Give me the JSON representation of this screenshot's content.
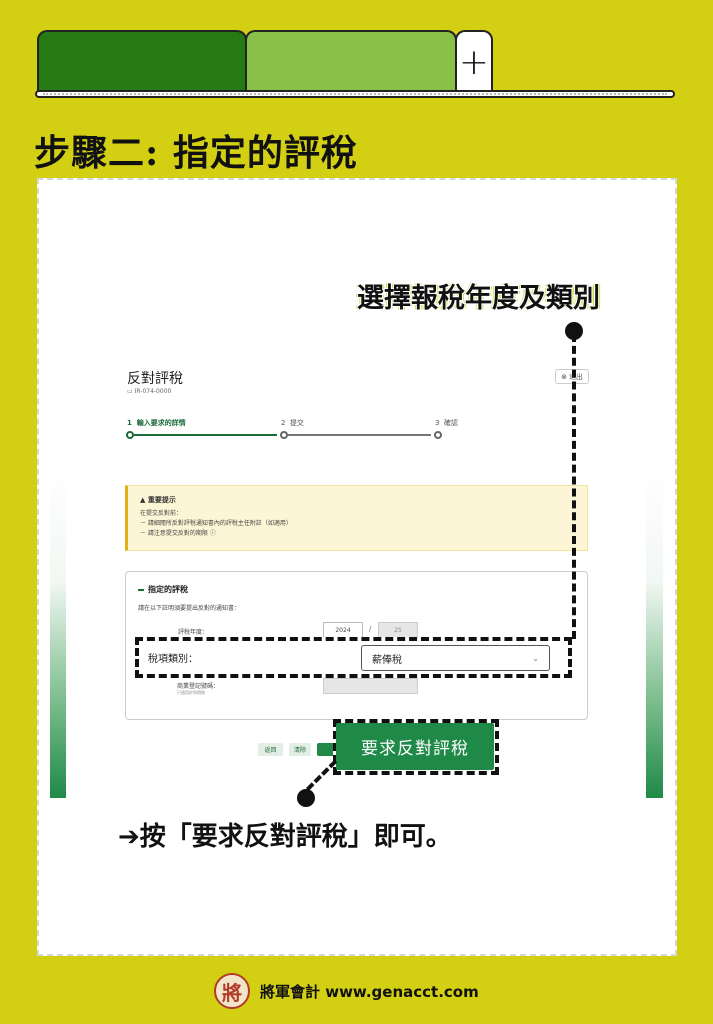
{
  "tabs": {
    "add_label": "+"
  },
  "step_title": "步驟二: 指定的評稅",
  "callout_top": "選擇報稅年度及類別",
  "app": {
    "title": "反對評稅",
    "subtitle": "IR-074-0000",
    "exit_label": "退出",
    "steps": [
      {
        "num": "1",
        "label": "輸入要求的詳情",
        "active": true
      },
      {
        "num": "2",
        "label": "提交",
        "active": false
      },
      {
        "num": "3",
        "label": "確認",
        "active": false
      }
    ],
    "notice": {
      "title": "重要提示",
      "lines": [
        "在提交反對前：",
        "－ 請細閱所反對評稅通知書內的評稅主任附註（如適用）",
        "－ 請注意提交反對的期限"
      ]
    },
    "form": {
      "heading": "指定的評稅",
      "description": "請在以下註明須要提出反對的通知書：",
      "year_label": "評稅年度：",
      "year_from": "2024",
      "year_sep": "/",
      "year_to": "25",
      "tax_type_label": "稅項類別：",
      "tax_type_value": "薪俸稅",
      "biz_label": "商業登記號碼：",
      "biz_note": "只適用於利得稅"
    },
    "buttons": {
      "back": "返回",
      "clear": "清除",
      "request": "要求反對評稅"
    }
  },
  "callout_bottom": "➔按「要求反對評稅」即可。",
  "footer": {
    "logo_char": "將",
    "text": "將軍會計 www.genacct.com"
  }
}
